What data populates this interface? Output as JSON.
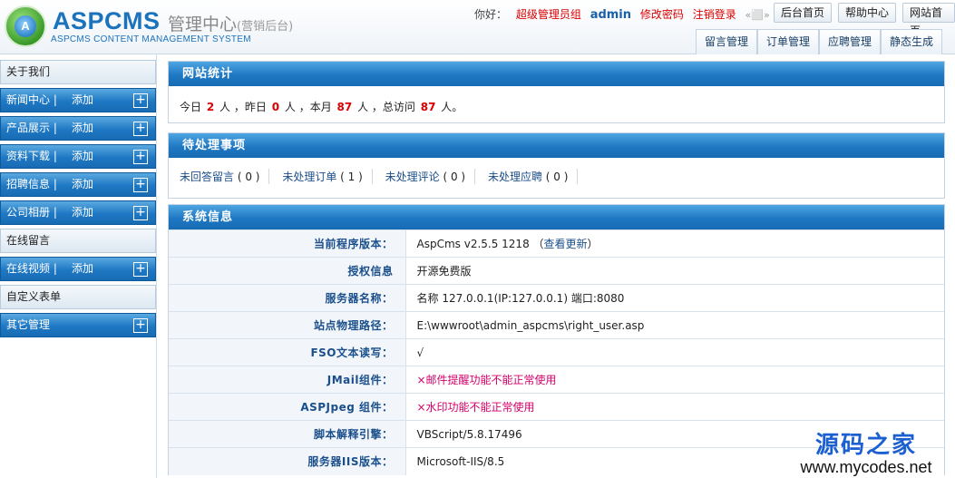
{
  "header": {
    "logo_letter": "A",
    "brand": "ASPCMS",
    "brand_cn": "管理中心",
    "brand_cn_small": "(营销后台)",
    "brand_sub": "ASPCMS CONTENT MANAGEMENT SYSTEM",
    "hello": "你好：",
    "user_group": "超级管理员组",
    "username": "admin",
    "change_password": "修改密码",
    "logout": "注销登录",
    "arrows": "«⬜»",
    "buttons": [
      "后台首页",
      "帮助中心",
      "网站首页"
    ],
    "tabs": [
      "留言管理",
      "订单管理",
      "应聘管理",
      "静态生成"
    ]
  },
  "sidebar": {
    "add_label": "添加",
    "items": [
      {
        "label": "关于我们",
        "type": "header"
      },
      {
        "label": "新闻中心 |",
        "type": "item"
      },
      {
        "label": "产品展示 |",
        "type": "item"
      },
      {
        "label": "资料下载 |",
        "type": "item"
      },
      {
        "label": "招聘信息 |",
        "type": "item"
      },
      {
        "label": "公司相册 |",
        "type": "item"
      },
      {
        "label": "在线留言",
        "type": "header"
      },
      {
        "label": "在线视频 |",
        "type": "item"
      },
      {
        "label": "自定义表单",
        "type": "header"
      },
      {
        "label": "其它管理",
        "type": "plus-only"
      }
    ]
  },
  "stats": {
    "title": "网站统计",
    "p1": "今日",
    "today": "2",
    "p2": "人 ，昨日",
    "yesterday": "0",
    "p3": "人 ，本月",
    "month": "87",
    "p4": "人 ，总访问",
    "total": "87",
    "p5": "人。"
  },
  "pending": {
    "title": "待处理事项",
    "items": [
      {
        "label": "未回答留言",
        "count": "( 0 )"
      },
      {
        "label": "未处理订单",
        "count": "( 1 )"
      },
      {
        "label": "未处理评论",
        "count": "( 0 )"
      },
      {
        "label": "未处理应聘",
        "count": "( 0 )"
      }
    ]
  },
  "system": {
    "title": "系统信息",
    "rows": [
      {
        "key": "当前程序版本：",
        "value": "AspCms v2.5.5 1218 （",
        "link": "查看更新",
        "tail": "）"
      },
      {
        "key": "授权信息",
        "value": "开源免费版"
      },
      {
        "key": "服务器名称：",
        "value": "名称 127.0.0.1(IP:127.0.0.1) 端口:8080"
      },
      {
        "key": "站点物理路径：",
        "value": "E:\\wwwroot\\admin_aspcms\\right_user.asp"
      },
      {
        "key": "FSO文本读写：",
        "value": "√"
      },
      {
        "key": "JMail组件：",
        "value": "×邮件提醒功能不能正常使用",
        "warn": true
      },
      {
        "key": "ASPJpeg 组件：",
        "value": "×水印功能不能正常使用",
        "warn": true
      },
      {
        "key": "脚本解释引擎：",
        "value": "VBScript/5.8.17496"
      },
      {
        "key": "服务器IIS版本：",
        "value": "Microsoft-IIS/8.5"
      }
    ]
  },
  "watermark": {
    "line1": "源码之家",
    "line2": "www.mycodes.net"
  }
}
